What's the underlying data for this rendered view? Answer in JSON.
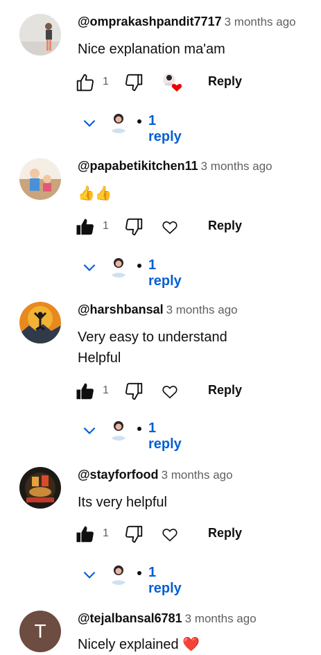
{
  "comments": [
    {
      "author": "@omprakashpandit7717",
      "time": "3 months ago",
      "text_lines": [
        "Nice explanation ma'am"
      ],
      "likes": "1",
      "reply_label": "Reply",
      "replies_label": "1 reply",
      "liked": false,
      "creator_heart": true
    },
    {
      "author": "@papabetikitchen11",
      "time": "3 months ago",
      "text_lines": [
        "👍👍"
      ],
      "likes": "1",
      "reply_label": "Reply",
      "replies_label": "1 reply",
      "liked": true,
      "creator_heart": false
    },
    {
      "author": "@harshbansal",
      "time": "3 months ago",
      "text_lines": [
        "Very easy to understand",
        "Helpful"
      ],
      "likes": "1",
      "reply_label": "Reply",
      "replies_label": "1 reply",
      "liked": true,
      "creator_heart": false
    },
    {
      "author": "@stayforfood",
      "time": "3 months ago",
      "text_lines": [
        "Its very helpful"
      ],
      "likes": "1",
      "reply_label": "Reply",
      "replies_label": "1 reply",
      "liked": true,
      "creator_heart": false
    },
    {
      "author": "@tejalbansal6781",
      "time": "3 months ago",
      "text_lines": [
        "Nicely explained ❤️"
      ],
      "avatar_letter": "T"
    }
  ],
  "colors": {
    "link_blue": "#065fd4",
    "heart_red": "#e00",
    "meta_gray": "#606060"
  }
}
